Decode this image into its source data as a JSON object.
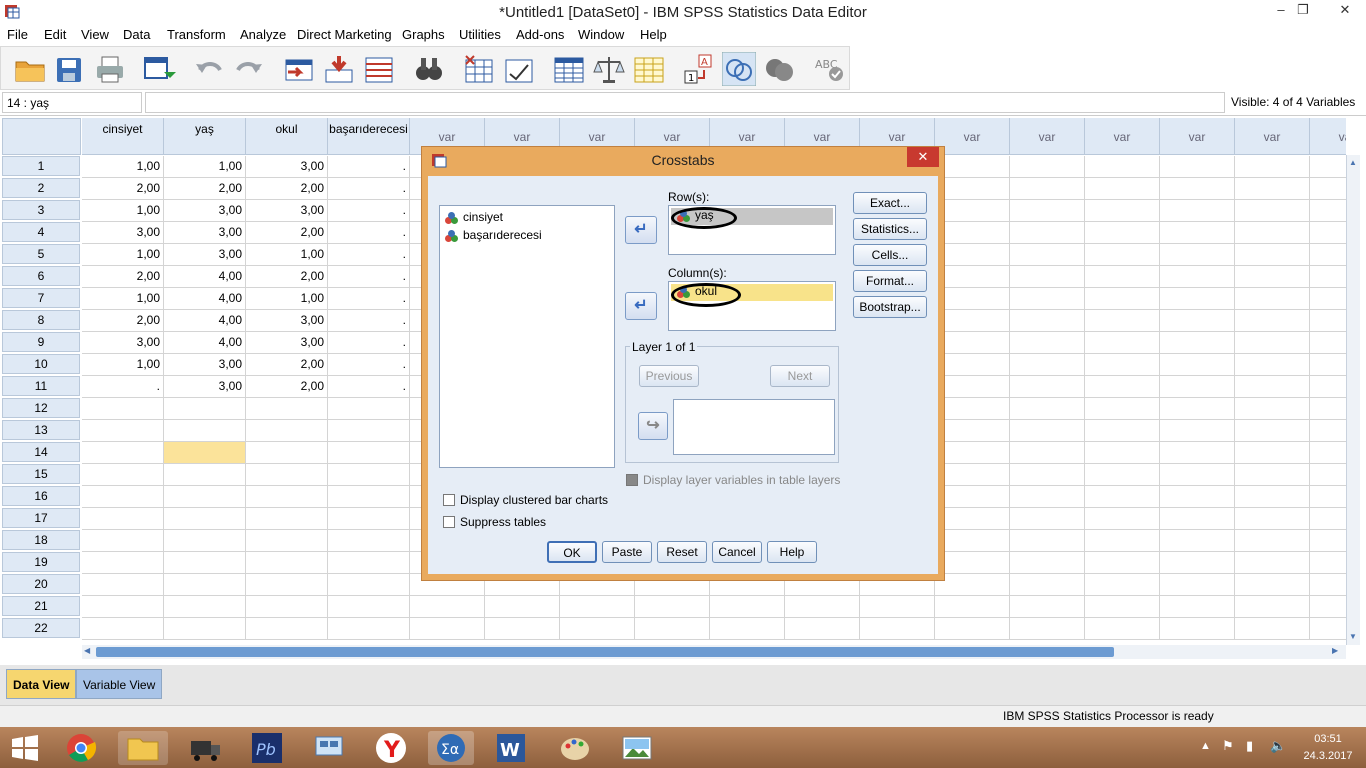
{
  "window": {
    "title": "*Untitled1 [DataSet0] - IBM SPSS Statistics Data Editor"
  },
  "menu": [
    "File",
    "Edit",
    "View",
    "Data",
    "Transform",
    "Analyze",
    "Direct Marketing",
    "Graphs",
    "Utilities",
    "Add-ons",
    "Window",
    "Help"
  ],
  "toolbar_icons": [
    "open-icon",
    "save-icon",
    "print-icon",
    "dialog-recall-icon",
    "undo-icon",
    "redo-icon",
    "goto-case-icon",
    "goto-variable-icon",
    "variables-icon",
    "find-icon",
    "insert-cases-icon",
    "insert-variable-icon",
    "split-file-icon",
    "weight-cases-icon",
    "select-cases-icon",
    "value-labels-icon",
    "use-sets-icon",
    "show-all-icon",
    "spellcheck-icon"
  ],
  "cellbar": {
    "ref": "14 : yaş",
    "visible": "Visible: 4 of 4 Variables"
  },
  "grid": {
    "columns": [
      "cinsiyet",
      "yaş",
      "okul",
      "başarıderecesi",
      "var",
      "var",
      "var",
      "var",
      "var",
      "var",
      "var",
      "var",
      "var",
      "var",
      "var",
      "var",
      "var"
    ],
    "rows": [
      {
        "n": "1",
        "c": [
          "1,00",
          "1,00",
          "3,00",
          "."
        ]
      },
      {
        "n": "2",
        "c": [
          "2,00",
          "2,00",
          "2,00",
          "."
        ]
      },
      {
        "n": "3",
        "c": [
          "1,00",
          "3,00",
          "3,00",
          "."
        ]
      },
      {
        "n": "4",
        "c": [
          "3,00",
          "3,00",
          "2,00",
          "."
        ]
      },
      {
        "n": "5",
        "c": [
          "1,00",
          "3,00",
          "1,00",
          "."
        ]
      },
      {
        "n": "6",
        "c": [
          "2,00",
          "4,00",
          "2,00",
          "."
        ]
      },
      {
        "n": "7",
        "c": [
          "1,00",
          "4,00",
          "1,00",
          "."
        ]
      },
      {
        "n": "8",
        "c": [
          "2,00",
          "4,00",
          "3,00",
          "."
        ]
      },
      {
        "n": "9",
        "c": [
          "3,00",
          "4,00",
          "3,00",
          "."
        ]
      },
      {
        "n": "10",
        "c": [
          "1,00",
          "3,00",
          "2,00",
          "."
        ]
      },
      {
        "n": "11",
        "c": [
          ".",
          "3,00",
          "2,00",
          "."
        ]
      },
      {
        "n": "12",
        "c": [
          "",
          "",
          "",
          ""
        ]
      },
      {
        "n": "13",
        "c": [
          "",
          "",
          "",
          ""
        ]
      },
      {
        "n": "14",
        "c": [
          "",
          "",
          "",
          ""
        ]
      },
      {
        "n": "15",
        "c": [
          "",
          "",
          "",
          ""
        ]
      },
      {
        "n": "16",
        "c": [
          "",
          "",
          "",
          ""
        ]
      },
      {
        "n": "17",
        "c": [
          "",
          "",
          "",
          ""
        ]
      },
      {
        "n": "18",
        "c": [
          "",
          "",
          "",
          ""
        ]
      },
      {
        "n": "19",
        "c": [
          "",
          "",
          "",
          ""
        ]
      },
      {
        "n": "20",
        "c": [
          "",
          "",
          "",
          ""
        ]
      },
      {
        "n": "21",
        "c": [
          "",
          "",
          "",
          ""
        ]
      },
      {
        "n": "22",
        "c": [
          "",
          "",
          "",
          ""
        ]
      }
    ]
  },
  "tabs": {
    "data_view": "Data View",
    "variable_view": "Variable View"
  },
  "status": "IBM SPSS Statistics Processor is ready",
  "dialog": {
    "title": "Crosstabs",
    "source_vars": [
      "cinsiyet",
      "başarıderecesi"
    ],
    "rows_label": "Row(s):",
    "rows_var": "yaş",
    "columns_label": "Column(s):",
    "columns_var": "okul",
    "layer_label": "Layer 1 of 1",
    "previous": "Previous",
    "next": "Next",
    "display_layer": "Display layer variables in table layers",
    "clustered": "Display clustered bar charts",
    "suppress": "Suppress tables",
    "side_buttons": [
      "Exact...",
      "Statistics...",
      "Cells...",
      "Format...",
      "Bootstrap..."
    ],
    "bottom_buttons": [
      "OK",
      "Paste",
      "Reset",
      "Cancel",
      "Help"
    ]
  },
  "taskbar": {
    "apps": [
      "windows-start-icon",
      "chrome-icon",
      "file-explorer-icon",
      "truck-app-icon",
      "pb-app-icon",
      "network-app-icon",
      "yandex-icon",
      "spss-icon",
      "word-icon",
      "paint-icon",
      "photos-icon"
    ],
    "time": "03:51",
    "date": "24.3.2017"
  }
}
